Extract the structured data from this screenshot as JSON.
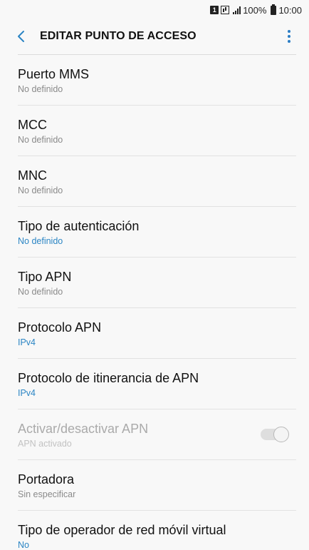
{
  "status_bar": {
    "sim_label": "1",
    "battery": "100%",
    "time": "10:00",
    "icons": [
      "sim-icon",
      "data-icon",
      "signal-icon",
      "battery-icon"
    ]
  },
  "header": {
    "title": "EDITAR PUNTO DE ACCESO",
    "back_icon": "chevron-left-icon",
    "more_icon": "more-vertical-icon"
  },
  "colors": {
    "accent": "#2b85c4",
    "background": "#f8f8f8",
    "secondary_text": "#8a8a8a",
    "disabled_text": "#aaaaaa"
  },
  "items": [
    {
      "title": "Puerto MMS",
      "subtitle": "No definido",
      "subtitle_style": "normal"
    },
    {
      "title": "MCC",
      "subtitle": "No definido",
      "subtitle_style": "normal"
    },
    {
      "title": "MNC",
      "subtitle": "No definido",
      "subtitle_style": "normal"
    },
    {
      "title": "Tipo de autenticación",
      "subtitle": "No definido",
      "subtitle_style": "accent"
    },
    {
      "title": "Tipo APN",
      "subtitle": "No definido",
      "subtitle_style": "normal"
    },
    {
      "title": "Protocolo APN",
      "subtitle": "IPv4",
      "subtitle_style": "accent"
    },
    {
      "title": "Protocolo de itinerancia de APN",
      "subtitle": "IPv4",
      "subtitle_style": "accent"
    },
    {
      "title": "Activar/desactivar APN",
      "subtitle": "APN activado",
      "subtitle_style": "disabled",
      "toggle": {
        "on": true,
        "enabled": false
      }
    },
    {
      "title": "Portadora",
      "subtitle": "Sin especificar",
      "subtitle_style": "normal"
    },
    {
      "title": "Tipo de operador de red móvil virtual",
      "subtitle": "No",
      "subtitle_style": "accent"
    }
  ]
}
